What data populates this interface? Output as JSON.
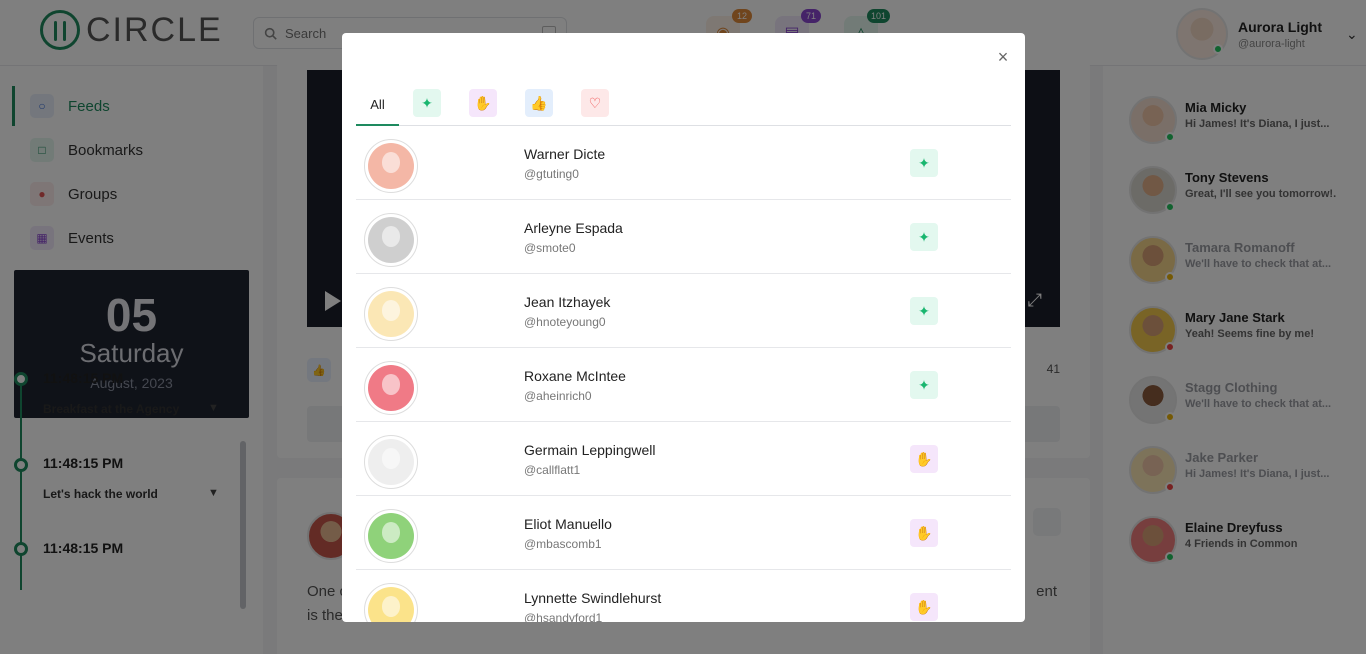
{
  "header": {
    "logo_text": "CIRCLE",
    "search_placeholder": "Search",
    "badges": {
      "friends": "12",
      "messages": "71",
      "notifications": "101"
    },
    "user": {
      "name": "Aurora Light",
      "handle": "@aurora-light"
    }
  },
  "sidebar": {
    "items": [
      {
        "label": "Feeds"
      },
      {
        "label": "Bookmarks"
      },
      {
        "label": "Groups"
      },
      {
        "label": "Events"
      }
    ],
    "date": {
      "day": "05",
      "weekday": "Saturday",
      "month_year": "August, 2023"
    },
    "events": [
      {
        "time": "11:48:15 PM",
        "title": "Breakfast at the Agency"
      },
      {
        "time": "11:48:15 PM",
        "title": "Let's hack the world"
      },
      {
        "time": "11:48:15 PM",
        "title": ""
      }
    ]
  },
  "feed": {
    "share_count": "41",
    "post2_text_left": "One c",
    "post2_text_left_line2": "is the",
    "post2_text_right": "ent"
  },
  "contacts": [
    {
      "name": "Mia Micky",
      "message": "Hi James! It's Diana, I just...",
      "status": "online"
    },
    {
      "name": "Tony Stevens",
      "message": "Great, I'll see you tomorrow!.",
      "status": "online"
    },
    {
      "name": "Tamara Romanoff",
      "message": "We'll have to check that at...",
      "status": "away"
    },
    {
      "name": "Mary Jane Stark",
      "message": "Yeah! Seems fine by me!",
      "status": "busy"
    },
    {
      "name": "Stagg Clothing",
      "message": "We'll have to check that at...",
      "status": "away"
    },
    {
      "name": "Jake Parker",
      "message": "Hi James! It's Diana, I just...",
      "status": "busy"
    },
    {
      "name": "Elaine Dreyfuss",
      "message": "4 Friends in Common",
      "status": "online"
    }
  ],
  "status_colors": {
    "online": "#22c55e",
    "away": "#eab308",
    "busy": "#ef4444"
  },
  "modal": {
    "close_icon": "×",
    "tabs": [
      {
        "label": "All"
      },
      {
        "icon": "sparkle-icon"
      },
      {
        "icon": "hand-icon"
      },
      {
        "icon": "thumbs-up-icon"
      },
      {
        "icon": "heart-icon"
      }
    ],
    "reactions": [
      {
        "name": "Warner Dicte",
        "handle": "@gtuting0",
        "reaction": "spark",
        "avatar_color": "#f4b7a6"
      },
      {
        "name": "Arleyne Espada",
        "handle": "@smote0",
        "reaction": "spark",
        "avatar_color": "#d9d9d9"
      },
      {
        "name": "Jean Itzhayek",
        "handle": "@hnoteyoung0",
        "reaction": "spark",
        "avatar_color": "#fbe7b5"
      },
      {
        "name": "Roxane McIntee",
        "handle": "@aheinrich0",
        "reaction": "spark",
        "avatar_color": "#f07a86"
      },
      {
        "name": "Germain Leppingwell",
        "handle": "@callflatt1",
        "reaction": "hand",
        "avatar_color": "#f3f3f3"
      },
      {
        "name": "Eliot Manuello",
        "handle": "@mbascomb1",
        "reaction": "hand",
        "avatar_color": "#8fd27a"
      },
      {
        "name": "Lynnette Swindlehurst",
        "handle": "@hsandyford1",
        "reaction": "hand",
        "avatar_color": "#fbe38a"
      }
    ]
  }
}
